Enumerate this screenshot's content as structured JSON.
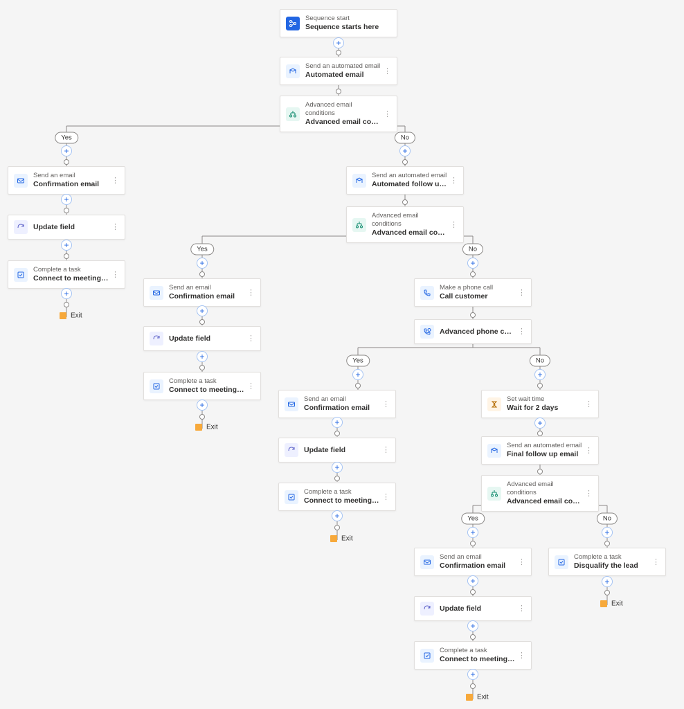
{
  "labels": {
    "yes": "Yes",
    "no": "No",
    "exit": "Exit"
  },
  "nodes": {
    "start": {
      "sub": "Sequence start",
      "title": "Sequence starts here"
    },
    "autoEmail1": {
      "sub": "Send an automated email",
      "title": "Automated email"
    },
    "cond1": {
      "sub": "Advanced email conditions",
      "title": "Advanced email conditions"
    },
    "confirmA": {
      "sub": "Send an email",
      "title": "Confirmation email"
    },
    "updateA": {
      "title": "Update field"
    },
    "taskA": {
      "sub": "Complete a task",
      "title": "Connect to meeting for product demo r..."
    },
    "autoFollow": {
      "sub": "Send an automated email",
      "title": "Automated follow up email"
    },
    "cond2": {
      "sub": "Advanced email conditions",
      "title": "Advanced email conditions"
    },
    "confirmB": {
      "sub": "Send an email",
      "title": "Confirmation email"
    },
    "updateB": {
      "title": "Update field"
    },
    "taskB": {
      "sub": "Complete a task",
      "title": "Connect to meeting for product demo r..."
    },
    "callCust": {
      "sub": "Make a phone call",
      "title": "Call customer"
    },
    "phoneCond": {
      "title": "Advanced phone condition"
    },
    "confirmC": {
      "sub": "Send an email",
      "title": "Confirmation email"
    },
    "updateC": {
      "title": "Update field"
    },
    "taskC": {
      "sub": "Complete a task",
      "title": "Connect to meeting for product demo r..."
    },
    "wait": {
      "sub": "Set wait time",
      "title": "Wait for 2 days"
    },
    "finalEmail": {
      "sub": "Send an automated email",
      "title": "Final follow up email"
    },
    "cond3": {
      "sub": "Advanced email conditions",
      "title": "Advanced email conditions"
    },
    "confirmD": {
      "sub": "Send an email",
      "title": "Confirmation email"
    },
    "updateD": {
      "title": "Update field"
    },
    "taskD": {
      "sub": "Complete a task",
      "title": "Connect to meeting for product demo r..."
    },
    "disqualify": {
      "sub": "Complete a task",
      "title": "Disqualify the lead"
    }
  }
}
